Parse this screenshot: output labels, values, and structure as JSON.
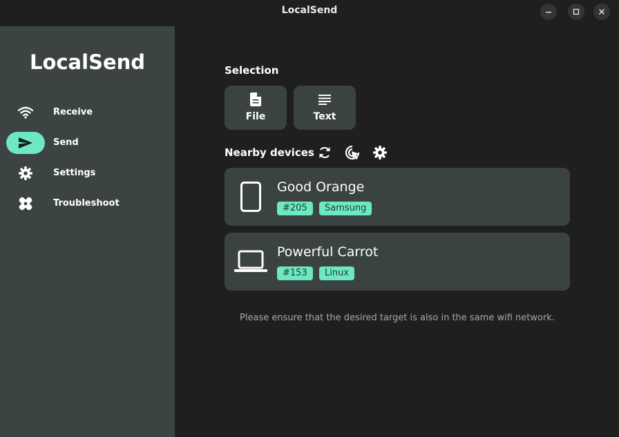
{
  "window": {
    "title": "LocalSend",
    "controls": [
      "minimize-icon",
      "maximize-icon",
      "close-icon"
    ]
  },
  "sidebar": {
    "app_title": "LocalSend",
    "items": [
      {
        "label": "Receive",
        "icon": "wifi-icon",
        "active": false
      },
      {
        "label": "Send",
        "icon": "send-icon",
        "active": true
      },
      {
        "label": "Settings",
        "icon": "gear-icon",
        "active": false
      },
      {
        "label": "Troubleshoot",
        "icon": "bandage-icon",
        "active": false
      }
    ]
  },
  "main": {
    "selection_title": "Selection",
    "selection_buttons": [
      {
        "label": "File",
        "icon": "file-icon"
      },
      {
        "label": "Text",
        "icon": "text-icon"
      }
    ],
    "nearby_title": "Nearby devices",
    "nearby_actions": [
      "refresh-icon",
      "manual-send-icon",
      "settings-icon"
    ],
    "devices": [
      {
        "name": "Good Orange",
        "icon": "phone-icon",
        "tags": [
          "#205",
          "Samsung"
        ]
      },
      {
        "name": "Powerful Carrot",
        "icon": "laptop-icon",
        "tags": [
          "#153",
          "Linux"
        ]
      }
    ],
    "hint": "Please ensure that the desired target is also in the same wifi network."
  },
  "colors": {
    "accent": "#6ee8c4",
    "sidebar_bg": "#3c4443",
    "card_bg": "#3b4341",
    "window_bg": "#1f1f1f"
  }
}
